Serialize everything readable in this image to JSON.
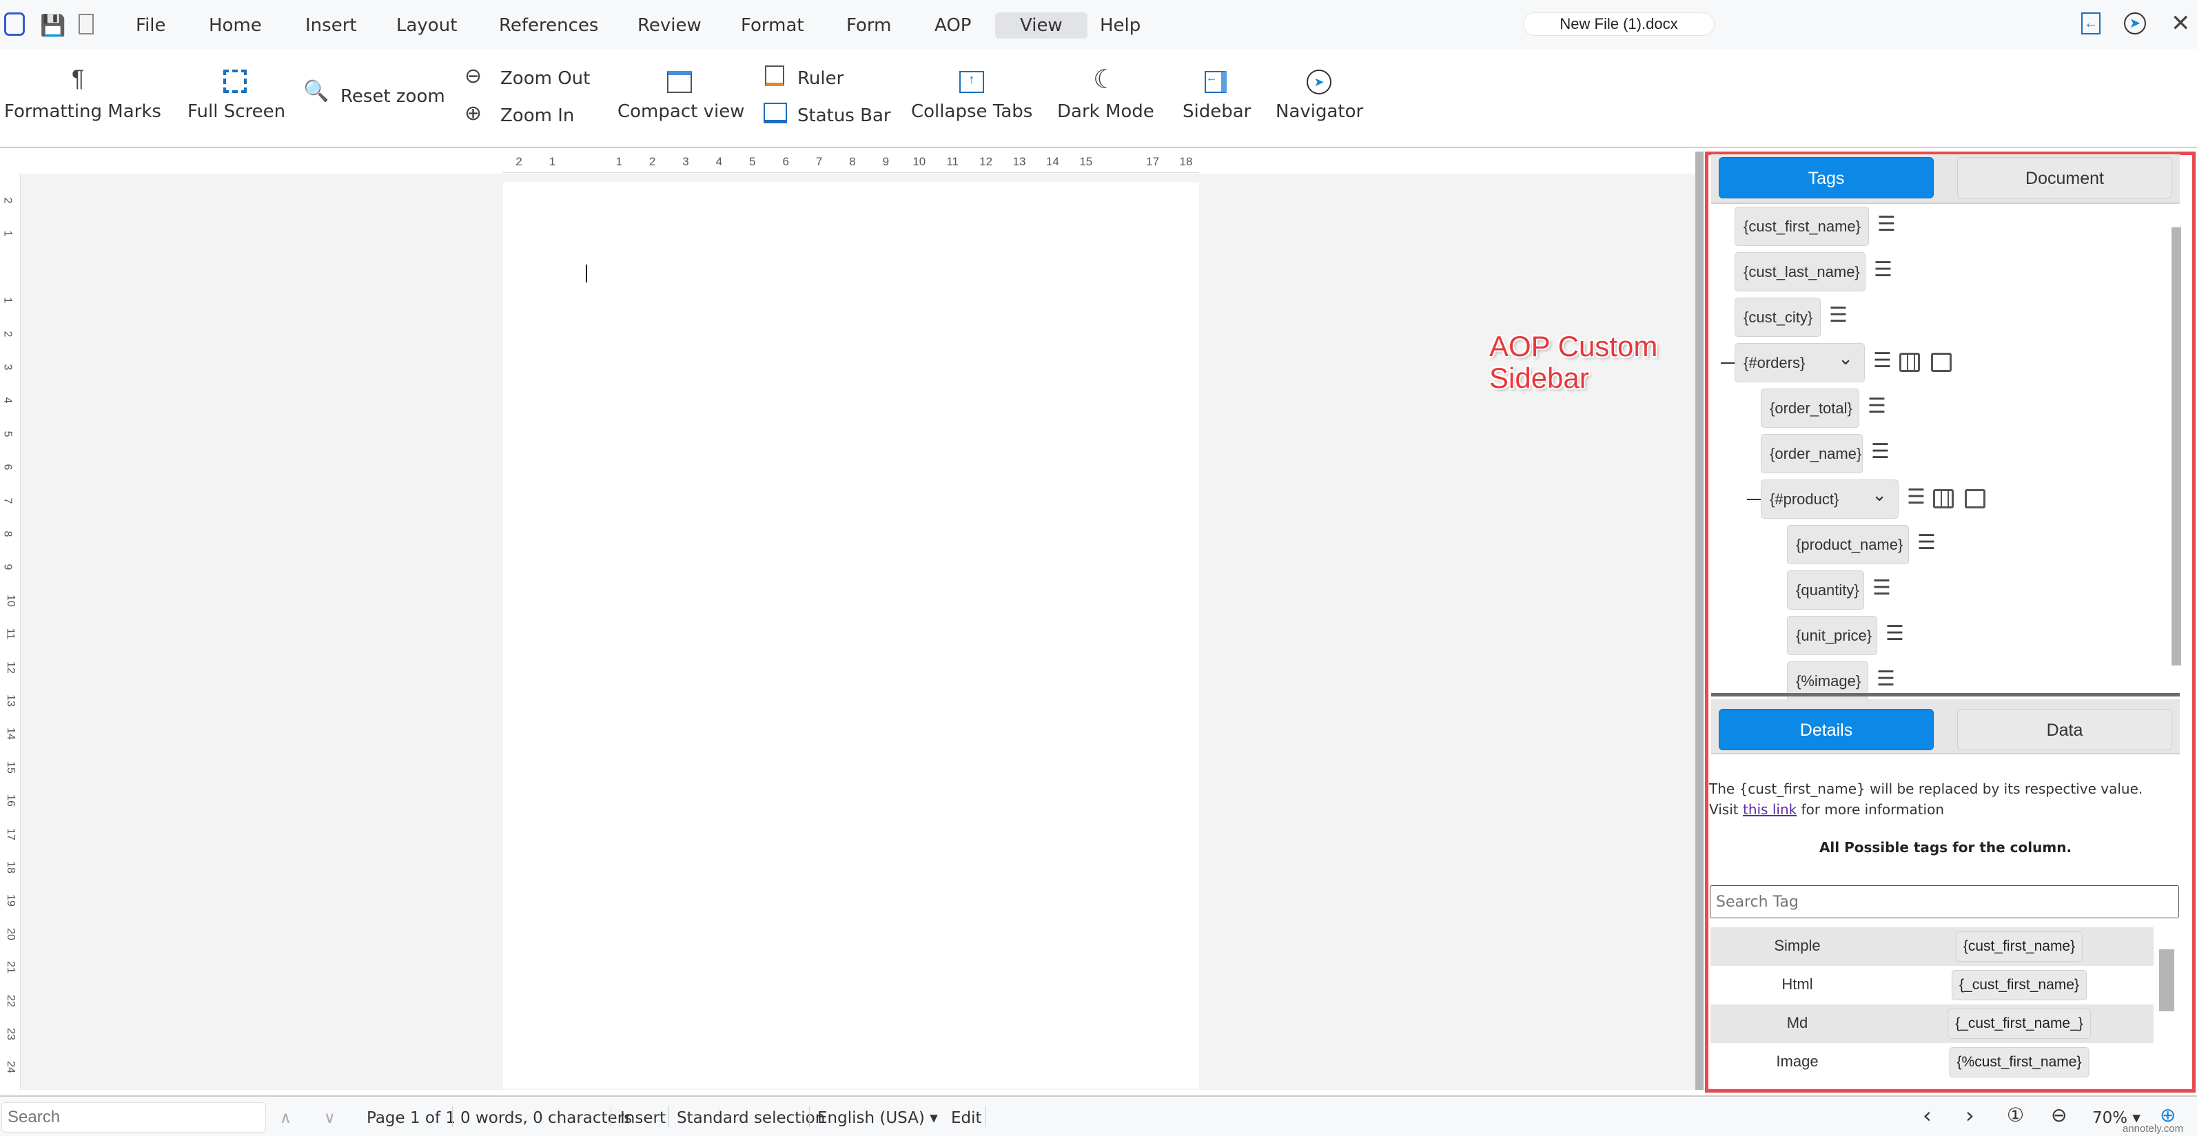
{
  "menubar": {
    "items": [
      "File",
      "Home",
      "Insert",
      "Layout",
      "References",
      "Review",
      "Format",
      "Form",
      "AOP",
      "View",
      "Help"
    ],
    "active": "View",
    "file_name": "New File (1).docx"
  },
  "toolbar": {
    "formatting_marks": "Formatting Marks",
    "full_screen": "Full Screen",
    "reset_zoom": "Reset zoom",
    "zoom_out": "Zoom Out",
    "zoom_in": "Zoom In",
    "compact_view": "Compact view",
    "ruler": "Ruler",
    "status_bar": "Status Bar",
    "collapse_tabs": "Collapse Tabs",
    "dark_mode": "Dark Mode",
    "sidebar": "Sidebar",
    "navigator": "Navigator"
  },
  "ruler": {
    "h": [
      "2",
      "1",
      "",
      "1",
      "2",
      "3",
      "4",
      "5",
      "6",
      "7",
      "8",
      "9",
      "10",
      "11",
      "12",
      "13",
      "14",
      "15",
      "",
      "17",
      "18"
    ],
    "v": [
      "2",
      "1",
      "",
      "1",
      "2",
      "3",
      "4",
      "5",
      "6",
      "7",
      "8",
      "9",
      "10",
      "11",
      "12",
      "13",
      "14",
      "15",
      "16",
      "17",
      "18",
      "19",
      "20",
      "21",
      "22",
      "23",
      "24"
    ]
  },
  "annotation": {
    "line1": "AOP Custom",
    "line2": "Sidebar",
    "color": "#e8383d"
  },
  "sidebar": {
    "tabs": {
      "tags": "Tags",
      "document": "Document"
    },
    "tags": [
      {
        "label": "{cust_first_name}",
        "level": 0
      },
      {
        "label": "{cust_last_name}",
        "level": 0
      },
      {
        "label": "{cust_city}",
        "level": 0
      },
      {
        "label": "{#orders}",
        "level": 0,
        "group": true
      },
      {
        "label": "{order_total}",
        "level": 1
      },
      {
        "label": "{order_name}",
        "level": 1
      },
      {
        "label": "{#product}",
        "level": 1,
        "group": true
      },
      {
        "label": "{product_name}",
        "level": 2
      },
      {
        "label": "{quantity}",
        "level": 2
      },
      {
        "label": "{unit_price}",
        "level": 2
      },
      {
        "label": "{%image}",
        "level": 2
      }
    ],
    "detail_tabs": {
      "details": "Details",
      "data": "Data"
    },
    "details": {
      "line1": "The {cust_first_name} will be replaced by its respective value.",
      "visit": "Visit",
      "link": "this link",
      "after_link": "for more information",
      "heading": "All Possible tags for the column.",
      "search_placeholder": "Search Tag"
    },
    "possible_tags": [
      {
        "type": "Simple",
        "tag": "{cust_first_name}"
      },
      {
        "type": "Html",
        "tag": "{_cust_first_name}"
      },
      {
        "type": "Md",
        "tag": "{_cust_first_name_}"
      },
      {
        "type": "Image",
        "tag": "{%cust_first_name}"
      }
    ],
    "accent": "#0c88e6"
  },
  "statusbar": {
    "search_placeholder": "Search",
    "page": "Page 1 of 1",
    "words": "0 words, 0 characters",
    "mode": "Insert",
    "selection": "Standard selection",
    "language": "English (USA)",
    "edit": "Edit",
    "zoom": "70%"
  },
  "watermark": "annotely.com"
}
